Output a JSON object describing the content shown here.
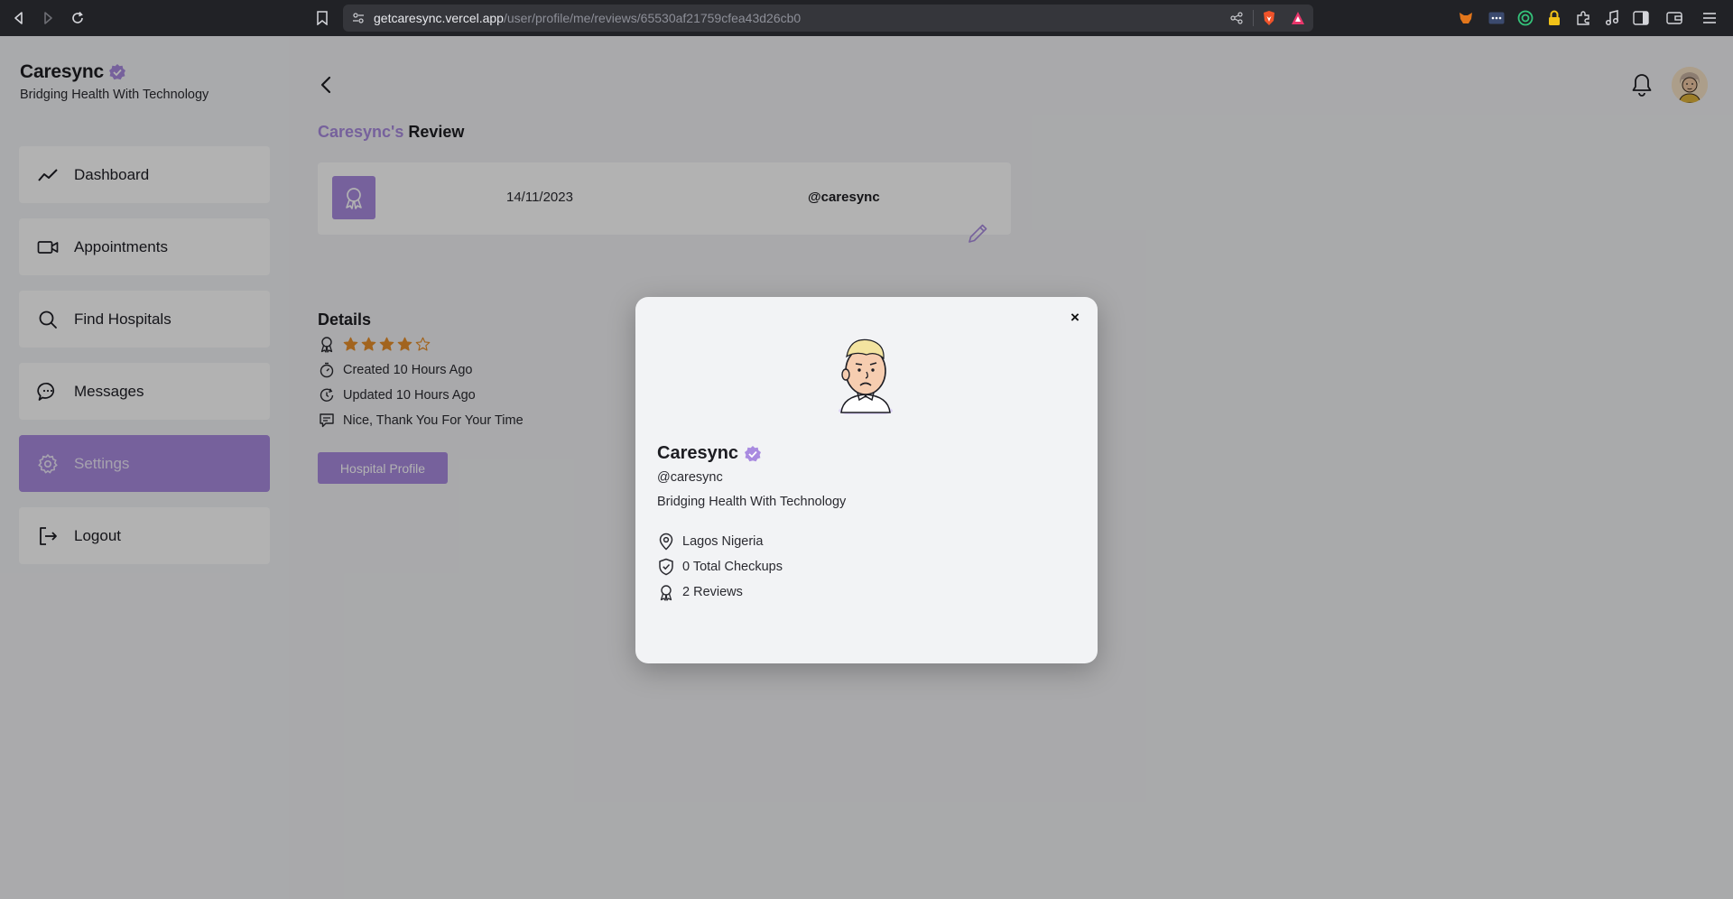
{
  "browser": {
    "url_host": "getcaresync.vercel.app",
    "url_path": "/user/profile/me/reviews/65530af21759cfea43d26cb0"
  },
  "brand": {
    "name": "Caresync",
    "tagline": "Bridging Health With Technology"
  },
  "sidebar": {
    "items": [
      {
        "label": "Dashboard",
        "icon": "trend-line-icon"
      },
      {
        "label": "Appointments",
        "icon": "video-camera-icon"
      },
      {
        "label": "Find Hospitals",
        "icon": "search-icon"
      },
      {
        "label": "Messages",
        "icon": "chat-bubble-icon"
      },
      {
        "label": "Settings",
        "icon": "gear-icon",
        "active": true
      },
      {
        "label": "Logout",
        "icon": "logout-icon"
      }
    ]
  },
  "page": {
    "title_accent": "Caresync's",
    "title_rest": "Review"
  },
  "review": {
    "date": "14/11/2023",
    "handle": "@caresync"
  },
  "details": {
    "title": "Details",
    "rating": 4,
    "rating_max": 5,
    "created": "Created 10 Hours Ago",
    "updated": "Updated 10 Hours Ago",
    "comment": "Nice, Thank You For Your Time",
    "button_label": "Hospital Profile"
  },
  "modal": {
    "close_label": "×",
    "name": "Caresync",
    "handle": "@caresync",
    "tagline": "Bridging Health With Technology",
    "location": "Lagos Nigeria",
    "checkups": "0 Total Checkups",
    "reviews": "2 Reviews"
  },
  "colors": {
    "accent": "#a98be0",
    "star": "#e8902c"
  }
}
